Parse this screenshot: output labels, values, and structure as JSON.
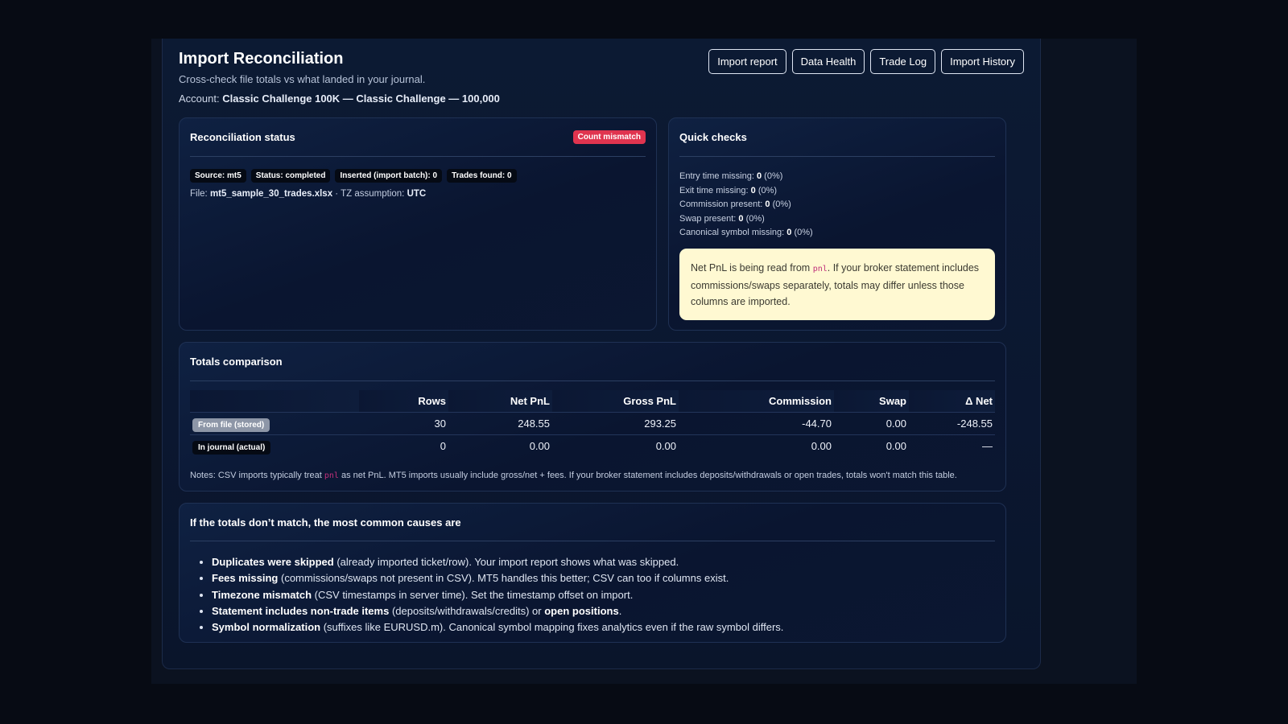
{
  "header": {
    "title": "Import Reconciliation",
    "subtitle": "Cross-check file totals vs what landed in your journal.",
    "account_label": "Account:",
    "account_value": "Classic Challenge 100K — Classic Challenge — 100,000"
  },
  "nav": {
    "import_report": "Import report",
    "data_health": "Data Health",
    "trade_log": "Trade Log",
    "import_history": "Import History"
  },
  "status_card": {
    "title": "Reconciliation status",
    "badge": "Count mismatch",
    "pills": [
      "Source: mt5",
      "Status: completed",
      "Inserted (import batch): 0",
      "Trades found: 0"
    ],
    "file_label": "File:",
    "file_value": "mt5_sample_30_trades.xlsx",
    "tz_label": "· TZ assumption:",
    "tz_value": "UTC"
  },
  "quick_checks": {
    "title": "Quick checks",
    "items": [
      {
        "label": "Entry time missing:",
        "value": "0",
        "pct": "(0%)"
      },
      {
        "label": "Exit time missing:",
        "value": "0",
        "pct": "(0%)"
      },
      {
        "label": "Commission present:",
        "value": "0",
        "pct": "(0%)"
      },
      {
        "label": "Swap present:",
        "value": "0",
        "pct": "(0%)"
      },
      {
        "label": "Canonical symbol missing:",
        "value": "0",
        "pct": "(0%)"
      }
    ],
    "note_pre": "Net PnL is being read from ",
    "note_code": "pnl",
    "note_post": ". If your broker statement includes commissions/swaps separately, totals may differ unless those columns are imported."
  },
  "totals": {
    "title": "Totals comparison",
    "columns": [
      "",
      "Rows",
      "Net PnL",
      "Gross PnL",
      "Commission",
      "Swap",
      "Δ Net"
    ],
    "rows": [
      {
        "label": "From file (stored)",
        "cells": [
          "30",
          "248.55",
          "293.25",
          "-44.70",
          "0.00",
          "-248.55"
        ]
      },
      {
        "label": "In journal (actual)",
        "cells": [
          "0",
          "0.00",
          "0.00",
          "0.00",
          "0.00",
          "—"
        ]
      }
    ],
    "notes_pre": "Notes: CSV imports typically treat ",
    "notes_code": "pnl",
    "notes_post": " as net PnL. MT5 imports usually include gross/net + fees. If your broker statement includes deposits/withdrawals or open trades, totals won't match this table."
  },
  "causes": {
    "title": "If the totals don’t match, the most common causes are",
    "items": [
      {
        "bold": "Duplicates were skipped",
        "text": " (already imported ticket/row). Your import report shows what was skipped."
      },
      {
        "bold": "Fees missing",
        "text": " (commissions/swaps not present in CSV). MT5 handles this better; CSV can too if columns exist."
      },
      {
        "bold": "Timezone mismatch",
        "text": " (CSV timestamps in server time). Set the timestamp offset on import."
      },
      {
        "bold": "Statement includes non-trade items",
        "text": " (deposits/withdrawals/credits) or ",
        "bold2": "open positions",
        "text2": "."
      },
      {
        "bold": "Symbol normalization",
        "text": " (suffixes like EURUSD.m). Canonical symbol mapping fixes analytics even if the raw symbol differs."
      }
    ]
  }
}
